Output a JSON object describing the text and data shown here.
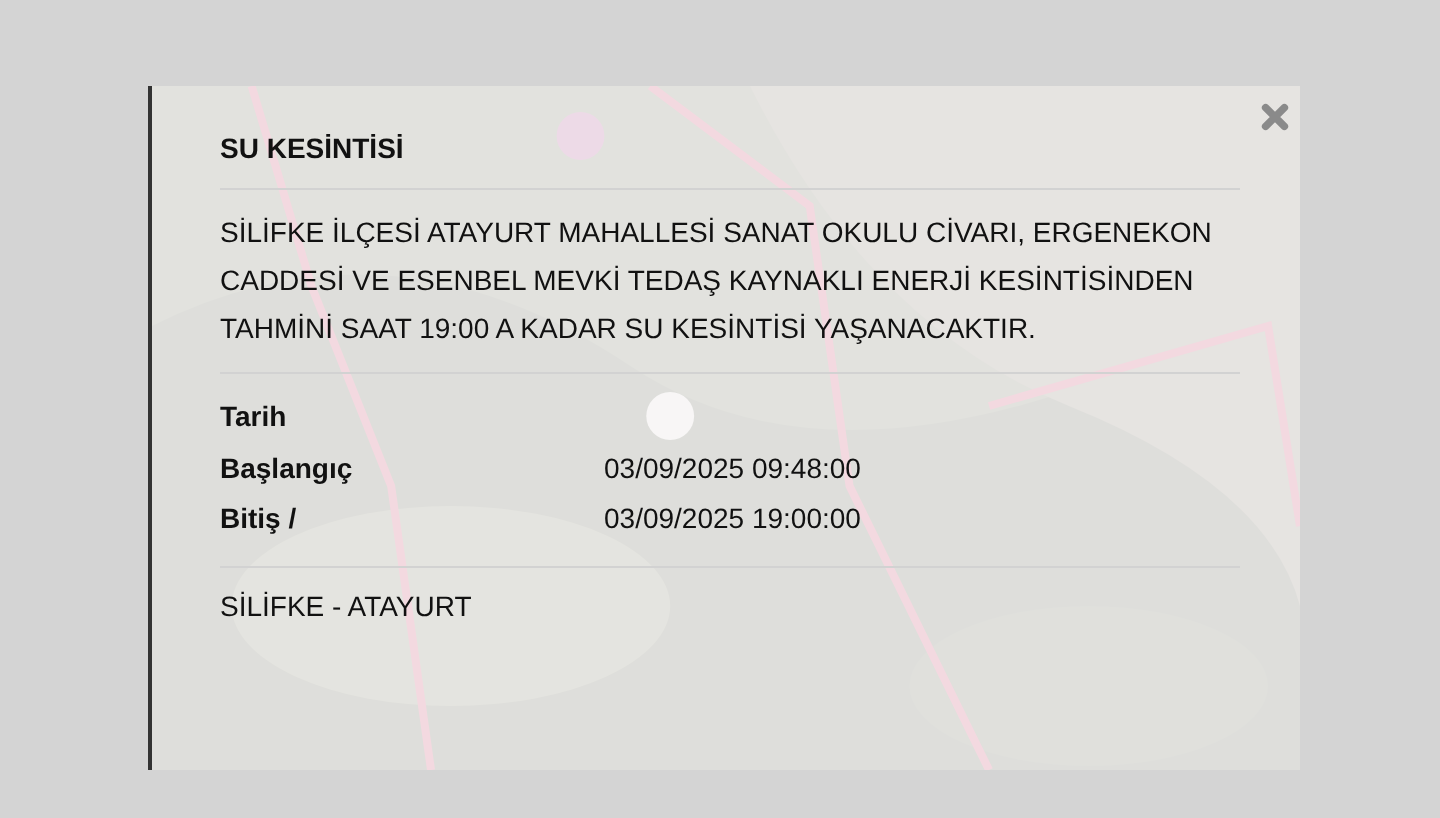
{
  "popup": {
    "title": "SU KESİNTİSİ",
    "message": "SİLİFKE İLÇESİ ATAYURT MAHALLESİ SANAT OKULU CİVARI, ERGENEKON CADDESİ VE ESENBEL MEVKİ TEDAŞ KAYNAKLI ENERJİ KESİNTİSİNDEN TAHMİNİ SAAT 19:00 A KADAR SU KESİNTİSİ YAŞANACAKTIR.",
    "details": [
      {
        "label": "Tarih"
      },
      {
        "label": "Başlangıç",
        "value": "03/09/2025 09:48:00"
      },
      {
        "label": "Bitiş /",
        "value": "03/09/2025 19:00:00"
      }
    ],
    "location": "SİLİFKE - ATAYURT"
  }
}
